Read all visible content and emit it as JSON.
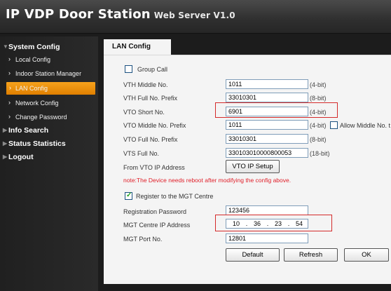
{
  "header": {
    "title": "IP VDP Door Station",
    "subtitle": "Web Server V1.0"
  },
  "sidebar": {
    "system_config": "System Config",
    "items": [
      {
        "label": "Local Config"
      },
      {
        "label": "Indoor Station Manager"
      },
      {
        "label": "LAN Config"
      },
      {
        "label": "Network Config"
      },
      {
        "label": "Change Password"
      }
    ],
    "info_search": "Info Search",
    "status_statistics": "Status Statistics",
    "logout": "Logout"
  },
  "tab": {
    "label": "LAN Config"
  },
  "form": {
    "group_call": {
      "label": "Group Call",
      "checked": false
    },
    "vth_middle": {
      "label": "VTH Middle No.",
      "value": "1011",
      "hint": "(4-bit)"
    },
    "vth_full_prefix": {
      "label": "VTH Full No. Prefix",
      "value": "33010301",
      "hint": "(8-bit)"
    },
    "vto_short": {
      "label": "VTO Short No.",
      "value": "6901",
      "hint": "(4-bit)"
    },
    "vto_middle": {
      "label": "VTO Middle No. Prefix",
      "value": "1011",
      "hint": "(4-bit)",
      "allow_label": "Allow Middle No. t"
    },
    "vto_full_prefix": {
      "label": "VTO Full No. Prefix",
      "value": "33010301",
      "hint": "(8-bit)"
    },
    "vts_full": {
      "label": "VTS Full No.",
      "value": "330103010000800053",
      "hint": "(18-bit)"
    },
    "from_vto_ip": {
      "label": "From VTO IP Address",
      "button": "VTO IP Setup"
    },
    "note": "note:The Device needs reboot after modifying the config above.",
    "register_mgt": {
      "label": "Register to the MGT Centre",
      "checked": true
    },
    "reg_password": {
      "label": "Registration Password",
      "value": "123456"
    },
    "mgt_ip": {
      "label": "MGT Centre IP Address",
      "seg1": "10",
      "seg2": "36",
      "seg3": "23",
      "seg4": "54",
      "dot": "."
    },
    "mgt_port": {
      "label": "MGT Port No.",
      "value": "12801"
    }
  },
  "buttons": {
    "default": "Default",
    "refresh": "Refresh",
    "ok": "OK"
  },
  "colors": {
    "accent": "#f29a12",
    "highlight_box": "#d42a2a",
    "note": "#e0202a"
  }
}
